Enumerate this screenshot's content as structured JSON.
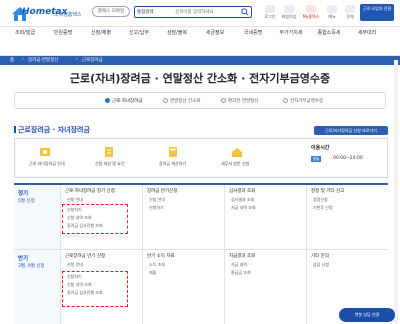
{
  "header": {
    "logo_text": "Hometax",
    "logo_sub": "국세청홈택스",
    "mode": "홈택스 모바일",
    "search_select": "통합검색",
    "search_placeholder": "검색어를 입력하세요",
    "utils": [
      "로그인",
      "회원가입",
      "My홈택스",
      "메뉴",
      "전체"
    ],
    "user_btn": "근로·사업자 전환"
  },
  "gnb": [
    "조회/발급",
    "민원증명",
    "신청/제출",
    "신고/납부",
    "상담/불복",
    "세금정보",
    "국세증명",
    "부가가치세",
    "종합소득세",
    "세무대리"
  ],
  "breadcrumb": [
    "홈",
    "장려금·연말정산",
    "근로장려금"
  ],
  "page_title": "근로(자녀)장려금 · 연말정산 간소화 · 전자기부금영수증",
  "tabs": [
    "근로·자녀장려금",
    "연말정산 간소화",
    "편리한 연말정산",
    "전자기부금영수증"
  ],
  "section_title": "근로장려금 · 자녀장려금",
  "section_btn": "근로/자녀장려금 신청 바로가기",
  "info": [
    "근로·자녀장려금 안내",
    "신청 대상 및 요건",
    "장려금 계산하기",
    "세무서 방문 신청"
  ],
  "hours": {
    "title": "이용시간",
    "badge": "평일",
    "value": "00:00~24:00"
  },
  "rows": [
    {
      "period": "정기",
      "period_date": "5월 신청",
      "cells": [
        {
          "title": "근로·자녀장려금 정기 신청",
          "items": [
            "신청 안내",
            "신청하기",
            "신청 내역 조회",
            "장려금 심사진행 조회"
          ]
        },
        {
          "title": "장려금 반기신청",
          "items": [
            "신청 안내",
            "신청하기"
          ]
        },
        {
          "title": "심사결과 조회",
          "items": [
            "심사결과 조회",
            "지급 내역 조회"
          ]
        },
        {
          "title": "정정 및 기타 신고",
          "items": [
            "정정신청",
            "기한후 신청"
          ]
        }
      ]
    },
    {
      "period": "반기",
      "period_date": "3월, 9월 신청",
      "cells": [
        {
          "title": "근로장려금 반기 신청",
          "items": [
            "신청 안내",
            "신청하기",
            "신청 내역 조회",
            "장려금 심사진행 조회"
          ]
        },
        {
          "title": "반기 소득 자료",
          "items": [
            "소득 조회",
            "제출"
          ]
        },
        {
          "title": "지급결과 조회",
          "items": [
            "지급 내역",
            "환급금 조회"
          ]
        },
        {
          "title": "기타 문의",
          "items": [
            "상담 신청"
          ]
        }
      ]
    }
  ],
  "chat_btn": "챗봇 상담 연결"
}
